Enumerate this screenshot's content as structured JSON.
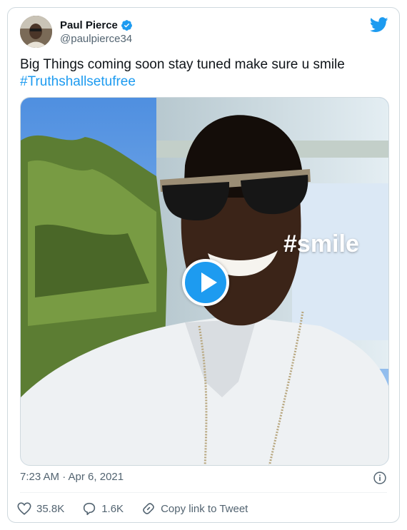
{
  "author": {
    "name": "Paul Pierce",
    "handle": "@paulpierce34"
  },
  "tweet": {
    "text": "Big Things coming soon stay tuned make sure u smile",
    "hashtag": "#Truthshallsetufree"
  },
  "media": {
    "overlay_text": "#smile",
    "type": "video"
  },
  "meta": {
    "timestamp": "7:23 AM · Apr 6, 2021"
  },
  "actions": {
    "likes": "35.8K",
    "replies": "1.6K",
    "copy_link_label": "Copy link to Tweet"
  },
  "colors": {
    "accent": "#1d9bf0",
    "secondary_text": "#536471",
    "border": "#cfd9de"
  },
  "icons": [
    "verified-badge-icon",
    "twitter-bird-icon",
    "play-icon",
    "info-icon",
    "heart-icon",
    "reply-icon",
    "link-icon"
  ]
}
